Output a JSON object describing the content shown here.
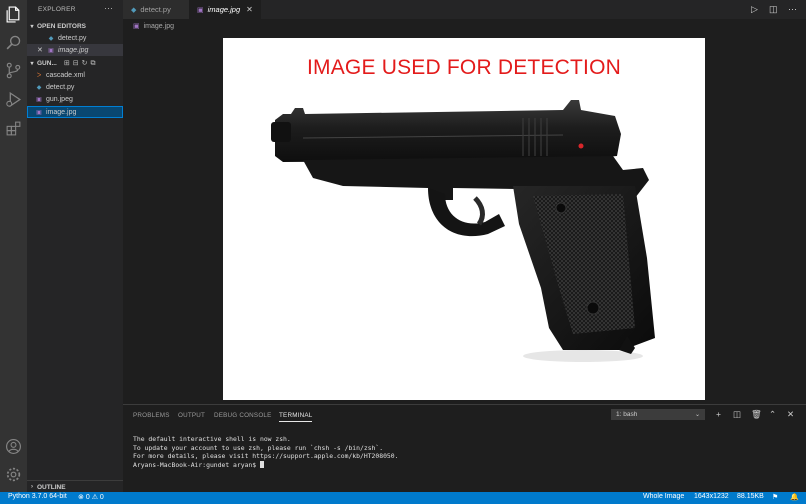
{
  "window": {
    "title": "image.jpg"
  },
  "activitybar": {
    "items": [
      "explorer-icon",
      "search-icon",
      "source-control-icon",
      "run-debug-icon",
      "extensions-icon"
    ],
    "bottom": [
      "account-icon",
      "settings-gear-icon"
    ]
  },
  "sidebar": {
    "title": "EXPLORER",
    "more": "···",
    "open_editors": {
      "label": "OPEN EDITORS",
      "files": [
        {
          "name": "detect.py",
          "icon": "python-file-icon"
        },
        {
          "name": "image.jpg",
          "icon": "image-file-icon",
          "close": "✕"
        }
      ]
    },
    "folder": {
      "label": "GUN...",
      "files": [
        {
          "name": "cascade.xml",
          "icon": "xml-file-icon"
        },
        {
          "name": "detect.py",
          "icon": "python-file-icon"
        },
        {
          "name": "gun.jpeg",
          "icon": "image-file-icon"
        },
        {
          "name": "image.jpg",
          "icon": "image-file-icon"
        }
      ]
    },
    "outline": {
      "label": "OUTLINE"
    }
  },
  "tabs": [
    {
      "label": "detect.py",
      "active": false
    },
    {
      "label": "image.jpg",
      "active": true,
      "close": "✕"
    }
  ],
  "breadcrumb": {
    "file": "image.jpg"
  },
  "preview": {
    "caption": "IMAGE USED FOR DETECTION"
  },
  "panel": {
    "tabs": [
      "PROBLEMS",
      "OUTPUT",
      "DEBUG CONSOLE",
      "TERMINAL"
    ],
    "active_tab": "TERMINAL",
    "terminal_select": "1: bash",
    "terminal_lines": [
      "The default interactive shell is now zsh.",
      "To update your account to use zsh, please run `chsh -s /bin/zsh`.",
      "For more details, please visit https://support.apple.com/kb/HT208050.",
      "Aryans-MacBook-Air:gundet aryan$ "
    ]
  },
  "statusbar": {
    "python": "Python 3.7.0 64-bit",
    "errors": "0",
    "warnings": "0",
    "zoom": "Whole Image",
    "dimensions": "1643x1232",
    "size": "88.15KB"
  },
  "colors": {
    "accent": "#007acc",
    "caption_red": "#e31b1b",
    "python_icon": "#519aba",
    "image_icon": "#a074c4",
    "xml_icon": "#e37933"
  }
}
